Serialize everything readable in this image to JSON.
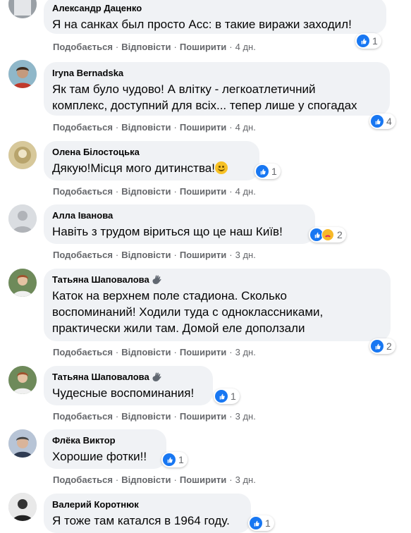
{
  "actions": {
    "like": "Подобається",
    "reply": "Відповісти",
    "share": "Поширити",
    "dot": "·"
  },
  "comments": [
    {
      "author": "Александр Даценко",
      "text": "Я на санках был просто Асс: в такие виражи заходил!",
      "time": "4 дн.",
      "reactions": "1",
      "reaction_types": [
        "like"
      ]
    },
    {
      "author": "Iryna Bernadska",
      "text_lines": [
        "Як там було чудово! А влітку - легкоатлетичний",
        "комплекс, доступний для всіх... тепер лише у спогадах"
      ],
      "time": "4 дн.",
      "reactions": "4",
      "reaction_types": [
        "like"
      ]
    },
    {
      "author": "Олена Білостоцька",
      "text": "Дякую!Місця мого дитинства!",
      "emoji": "smiling-face",
      "time": "4 дн.",
      "reactions": "1",
      "reaction_types": [
        "like"
      ]
    },
    {
      "author": "Алла Іванова",
      "text": "Навіть з трудом віриться що це наш Київ!",
      "time": "3 дн.",
      "reactions": "2",
      "reaction_types": [
        "like",
        "care"
      ]
    },
    {
      "author": "Татьяна Шаповалова",
      "author_badge": "waving-hand-icon",
      "text_lines": [
        "Каток на верхнем поле стадиона. Сколько",
        "воспоминаний! Ходили туда с одноклассниками,",
        "практически жили там. Домой еле доползали"
      ],
      "time": "3 дн.",
      "reactions": "2",
      "reaction_types": [
        "like"
      ]
    },
    {
      "author": "Татьяна Шаповалова",
      "author_badge": "waving-hand-icon",
      "text": "Чудесные воспоминания!",
      "time": "3 дн.",
      "reactions": "1",
      "reaction_types": [
        "like"
      ]
    },
    {
      "author": "Флёка Виктор",
      "text": "Хорошие фотки!!",
      "time": "3 дн.",
      "reactions": "1",
      "reaction_types": [
        "like"
      ]
    },
    {
      "author": "Валерий Коротнюк",
      "text": "Я тоже там катался в 1964 году.",
      "time": "",
      "reactions": "1",
      "reaction_types": [
        "like"
      ]
    }
  ],
  "colors": {
    "bubble": "#f0f2f5",
    "meta_text": "#65676b",
    "like_blue": "#1877f2"
  }
}
